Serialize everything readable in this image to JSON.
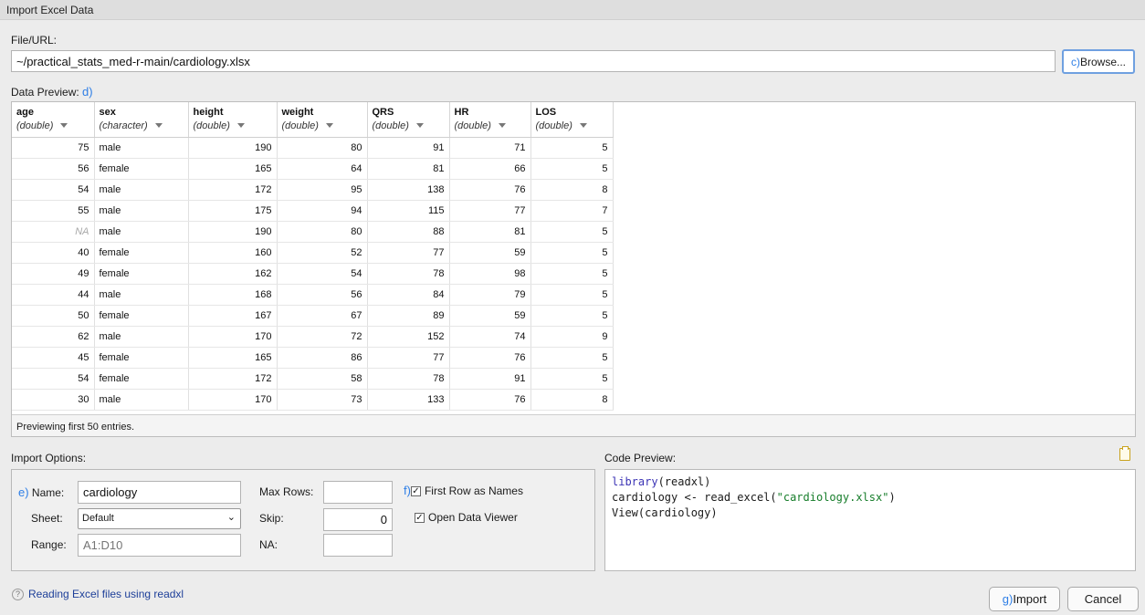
{
  "window": {
    "title": "Import Excel Data"
  },
  "file": {
    "label": "File/URL:",
    "value": "~/practical_stats_med-r-main/cardiology.xlsx",
    "browse_annotation": "c)",
    "browse_label": "Browse..."
  },
  "preview": {
    "label": "Data Preview:",
    "annotation": "d)",
    "footer": "Previewing first 50 entries.",
    "columns": [
      {
        "name": "age",
        "type": "(double)"
      },
      {
        "name": "sex",
        "type": "(character)"
      },
      {
        "name": "height",
        "type": "(double)"
      },
      {
        "name": "weight",
        "type": "(double)"
      },
      {
        "name": "QRS",
        "type": "(double)"
      },
      {
        "name": "HR",
        "type": "(double)"
      },
      {
        "name": "LOS",
        "type": "(double)"
      }
    ],
    "rows": [
      [
        "75",
        "male",
        "190",
        "80",
        "91",
        "71",
        "5"
      ],
      [
        "56",
        "female",
        "165",
        "64",
        "81",
        "66",
        "5"
      ],
      [
        "54",
        "male",
        "172",
        "95",
        "138",
        "76",
        "8"
      ],
      [
        "55",
        "male",
        "175",
        "94",
        "115",
        "77",
        "7"
      ],
      [
        "NA",
        "male",
        "190",
        "80",
        "88",
        "81",
        "5"
      ],
      [
        "40",
        "female",
        "160",
        "52",
        "77",
        "59",
        "5"
      ],
      [
        "49",
        "female",
        "162",
        "54",
        "78",
        "98",
        "5"
      ],
      [
        "44",
        "male",
        "168",
        "56",
        "84",
        "79",
        "5"
      ],
      [
        "50",
        "female",
        "167",
        "67",
        "89",
        "59",
        "5"
      ],
      [
        "62",
        "male",
        "170",
        "72",
        "152",
        "74",
        "9"
      ],
      [
        "45",
        "female",
        "165",
        "86",
        "77",
        "76",
        "5"
      ],
      [
        "54",
        "female",
        "172",
        "58",
        "78",
        "91",
        "5"
      ],
      [
        "30",
        "male",
        "170",
        "73",
        "133",
        "76",
        "8"
      ]
    ]
  },
  "options": {
    "label": "Import Options:",
    "name_annotation": "e)",
    "name_label": "Name:",
    "name_value": "cardiology",
    "sheet_label": "Sheet:",
    "sheet_value": "Default",
    "range_label": "Range:",
    "range_placeholder": "A1:D10",
    "max_rows_label": "Max Rows:",
    "max_rows_value": "",
    "skip_label": "Skip:",
    "skip_value": "0",
    "na_label": "NA:",
    "na_value": "",
    "first_row_annotation": "f)",
    "first_row_label": "First Row as Names",
    "first_row_checked": true,
    "open_viewer_label": "Open Data Viewer",
    "open_viewer_checked": true
  },
  "code": {
    "label": "Code Preview:",
    "line1_kw": "library",
    "line1_rest": "(readxl)",
    "line2_pre": "cardiology <- read_excel(",
    "line2_str": "\"cardiology.xlsx\"",
    "line2_post": ")",
    "line3": "View(cardiology)"
  },
  "footer": {
    "help_glyph": "?",
    "help_link": "Reading Excel files using readxl",
    "import_annotation": "g)",
    "import_label": "Import",
    "cancel_label": "Cancel"
  },
  "colors": {
    "accent": "#2f7fe6",
    "link": "#1d3f99",
    "code_keyword": "#3b33b5",
    "code_string": "#167d2a"
  }
}
